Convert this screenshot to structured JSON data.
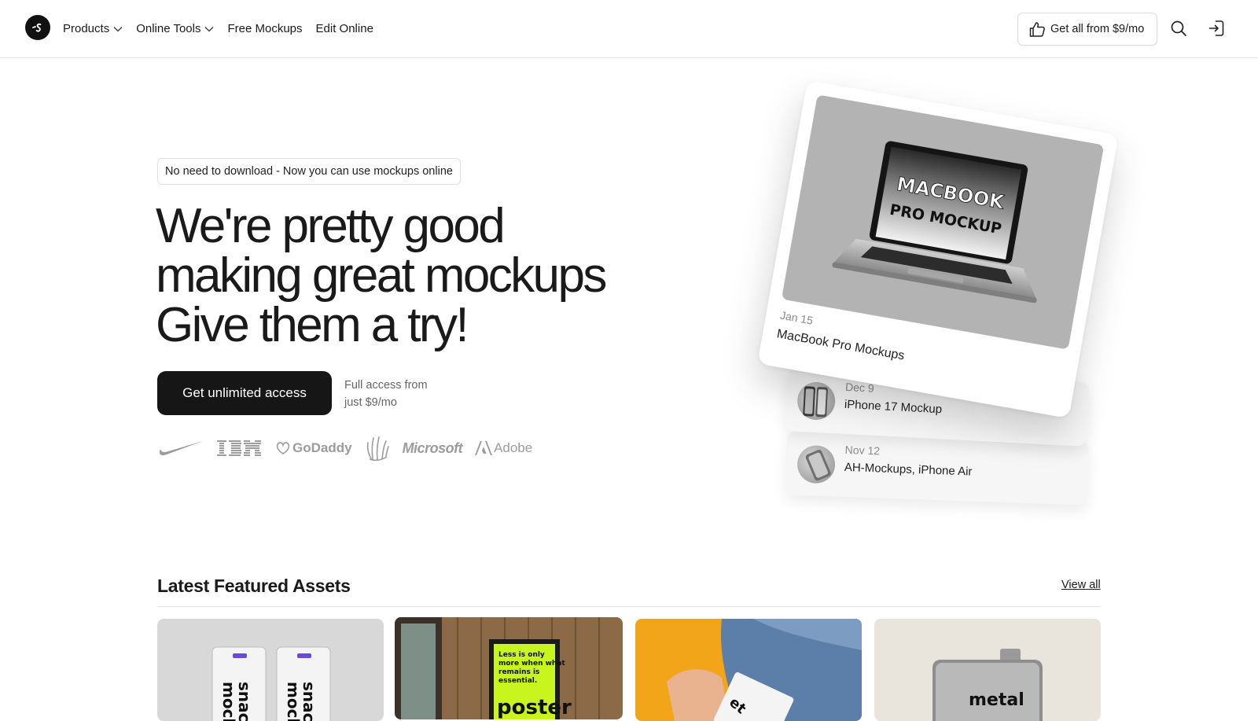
{
  "header": {
    "logo_icon": "brand-logo-icon",
    "nav": [
      {
        "label": "Products",
        "has_dropdown": true
      },
      {
        "label": "Online Tools",
        "has_dropdown": true
      },
      {
        "label": "Free Mockups",
        "has_dropdown": false
      },
      {
        "label": "Edit Online",
        "has_dropdown": false
      }
    ],
    "cta_label": "Get all from $9/mo",
    "cta_icon": "thumbs-up-icon",
    "search_icon": "search-icon",
    "login_icon": "sign-in-icon"
  },
  "hero": {
    "pill_text": "No need to download - Now you can use mockups online",
    "headline_lines": [
      "We're pretty good",
      "making great mockups",
      "Give them a try!"
    ],
    "cta_label": "Get unlimited access",
    "cta_note_lines": [
      "Full access from",
      "just $9/mo"
    ],
    "brands": [
      "nike-logo",
      "ibm-logo",
      "GoDaddy",
      "hand-logo",
      "Microsoft",
      "Adobe"
    ]
  },
  "cards": {
    "main": {
      "date": "Jan 15",
      "title": "MacBook Pro Mockups",
      "screen_text_1": "MACBOOK",
      "screen_text_2": "PRO MOCKUP"
    },
    "items": [
      {
        "date": "Dec 9",
        "title": "iPhone 17 Mockup"
      },
      {
        "date": "Nov 12",
        "title": "AH-Mockups, iPhone Air"
      }
    ]
  },
  "featured": {
    "title": "Latest Featured Assets",
    "view_all": "View all",
    "tiles": [
      {
        "label_1": "snac",
        "label_2": "mock"
      },
      {
        "poster_line_1": "Less is only",
        "poster_line_2": "more when what",
        "poster_line_3": "remains is",
        "poster_line_4": "essential.",
        "poster_word": "poster"
      },
      {
        "label": "et"
      },
      {
        "label": "metal"
      }
    ]
  },
  "colors": {
    "accent": "#161616",
    "poster_green": "#c8f51e",
    "tile_orange": "#f3a51a"
  }
}
